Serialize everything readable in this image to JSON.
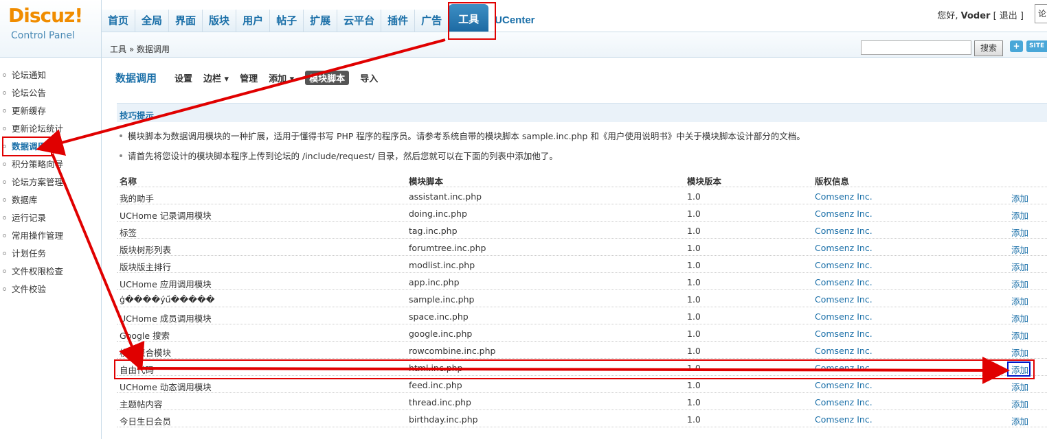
{
  "logo": {
    "brand": "Discuz!",
    "sub": "Control Panel"
  },
  "topnav": [
    "首页",
    "全局",
    "界面",
    "版块",
    "用户",
    "帖子",
    "扩展",
    "云平台",
    "插件",
    "广告",
    "工具",
    "UCenter"
  ],
  "user": {
    "greeting": "您好,",
    "name": "Voder",
    "logout": "[ 退出 ]",
    "search_partial": "论"
  },
  "breadcrumb": "工具 » 数据调用",
  "search_button": "搜索",
  "plus_button": "+",
  "site_button": "SITE",
  "sidebar": [
    "论坛通知",
    "论坛公告",
    "更新缓存",
    "更新论坛统计",
    "数据调用",
    "积分策略向导",
    "论坛方案管理",
    "数据库",
    "运行记录",
    "常用操作管理",
    "计划任务",
    "文件权限检查",
    "文件校验"
  ],
  "page_title": "数据调用",
  "subtabs": [
    "设置",
    "边栏 ▾",
    "管理",
    "添加 ▾",
    "模块脚本",
    "导入"
  ],
  "tips": {
    "title": "技巧提示",
    "lines": [
      "模块脚本为数据调用模块的一种扩展，适用于懂得书写 PHP 程序的程序员。请参考系统自带的模块脚本 sample.inc.php 和《用户使用说明书》中关于模块脚本设计部分的文档。",
      "请首先将您设计的模块脚本程序上传到论坛的 /include/request/ 目录，然后您就可以在下面的列表中添加他了。"
    ]
  },
  "table": {
    "headers": [
      "名称",
      "模块脚本",
      "模块版本",
      "版权信息"
    ],
    "rows": [
      [
        "我的助手",
        "assistant.inc.php",
        "1.0",
        "Comsenz Inc.",
        "添加"
      ],
      [
        "UCHome 记录调用模块",
        "doing.inc.php",
        "1.0",
        "Comsenz Inc.",
        "添加"
      ],
      [
        "标签",
        "tag.inc.php",
        "1.0",
        "Comsenz Inc.",
        "添加"
      ],
      [
        "版块树形列表",
        "forumtree.inc.php",
        "1.0",
        "Comsenz Inc.",
        "添加"
      ],
      [
        "版块版主排行",
        "modlist.inc.php",
        "1.0",
        "Comsenz Inc.",
        "添加"
      ],
      [
        "UCHome 应用调用模块",
        "app.inc.php",
        "1.0",
        "Comsenz Inc.",
        "添加"
      ],
      [
        "ģ����ýű�����",
        "sample.inc.php",
        "1.0",
        "Comsenz Inc.",
        "添加"
      ],
      [
        "UCHome 成员调用模块",
        "space.inc.php",
        "1.0",
        "Comsenz Inc.",
        "添加"
      ],
      [
        "Google 搜索",
        "google.inc.php",
        "1.0",
        "Comsenz Inc.",
        "添加"
      ],
      [
        "横向聚合模块",
        "rowcombine.inc.php",
        "1.0",
        "Comsenz Inc.",
        "添加"
      ],
      [
        "自由代码",
        "html.inc.php",
        "1.0",
        "Comsenz Inc.",
        "添加"
      ],
      [
        "UCHome 动态调用模块",
        "feed.inc.php",
        "1.0",
        "Comsenz Inc.",
        "添加"
      ],
      [
        "主题帖内容",
        "thread.inc.php",
        "1.0",
        "Comsenz Inc.",
        "添加"
      ],
      [
        "今日生日会员",
        "birthday.inc.php",
        "1.0",
        "Comsenz Inc.",
        "添加"
      ]
    ]
  },
  "colors": {
    "accent": "#1a6fa8",
    "annotation_red": "#e00000",
    "annotation_blue": "#0018c8"
  }
}
